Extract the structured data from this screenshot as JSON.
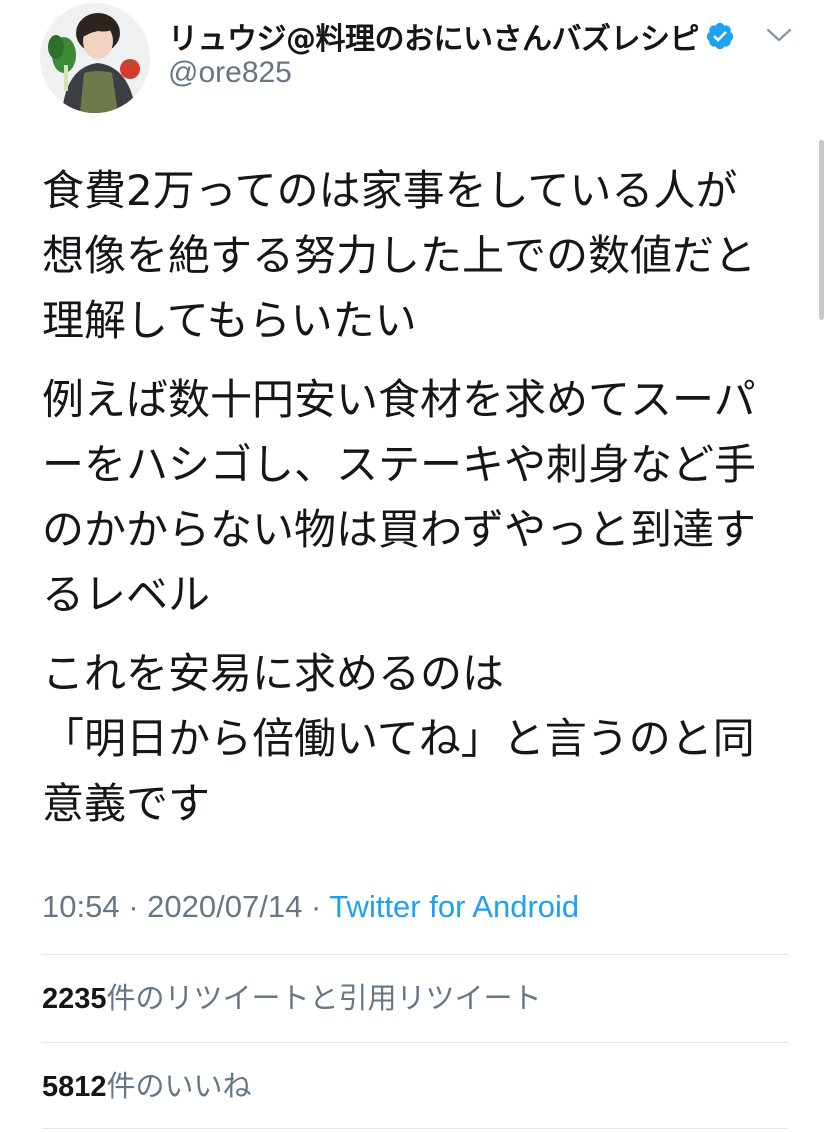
{
  "user": {
    "display_name": "リュウジ@料理のおにいさんバズレシピ",
    "handle": "@ore825",
    "verified": true
  },
  "tweet": {
    "paragraphs": [
      [
        "食費2万ってのは家事をしている人が",
        "想像を絶する努力した上での数値だと",
        "理解してもらいたい"
      ],
      [
        "例えば数十円安い食材を求めてスーパ",
        "ーをハシゴし、ステーキや刺身など手",
        "のかからない物は買わずやっと到達す",
        "るレベル"
      ],
      [
        "これを安易に求めるのは",
        "「明日から倍働いてね」と言うのと同",
        "意義です"
      ]
    ]
  },
  "meta": {
    "time": "10:54",
    "separator": "·",
    "date": "2020/07/14",
    "source": "Twitter for Android"
  },
  "stats": {
    "retweets_count": "2235",
    "retweets_label": "件のリツイートと引用リツイート",
    "likes_count": "5812",
    "likes_label": "件のいいね"
  },
  "colors": {
    "text": "#14171a",
    "secondary": "#657786",
    "link": "#1da1f2",
    "verified": "#1da1f2",
    "divider": "#e1e8ed"
  },
  "icons": {
    "verified": "verified-badge-icon",
    "caret": "chevron-down-icon"
  }
}
